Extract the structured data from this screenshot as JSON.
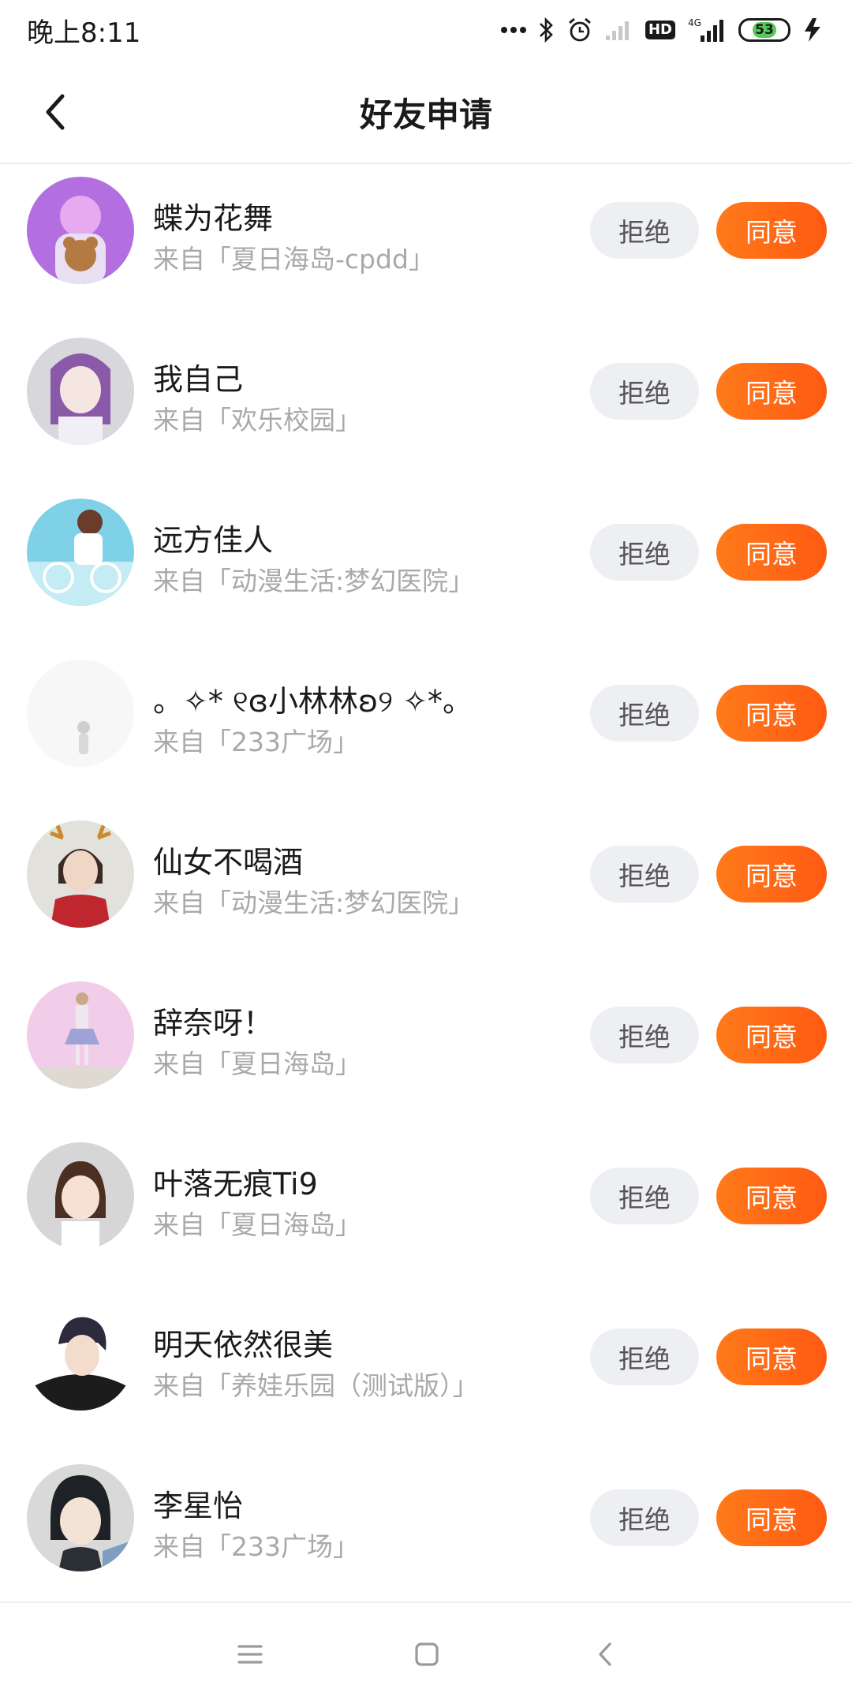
{
  "status_bar": {
    "time": "晚上8:11",
    "network": "4G",
    "hd": "HD",
    "battery": "53"
  },
  "header": {
    "title": "好友申请"
  },
  "buttons": {
    "reject": "拒绝",
    "accept": "同意"
  },
  "requests": [
    {
      "name": "蝶为花舞",
      "source": "来自「夏日海岛-cpdd」",
      "avatar_color": "#b36fe0"
    },
    {
      "name": "我自己",
      "source": "来自「欢乐校园」",
      "avatar_color": "#d7d7dc"
    },
    {
      "name": "远方佳人",
      "source": "来自「动漫生活:梦幻医院」",
      "avatar_color": "#7fd1e8"
    },
    {
      "name": "。✧* ୧ɞ小林林ʚ୨ ✧*。",
      "source": "来自「233广场」",
      "avatar_color": "#f7f7f7"
    },
    {
      "name": "仙女不喝酒",
      "source": "来自「动漫生活:梦幻医院」",
      "avatar_color": "#e3e1dc"
    },
    {
      "name": "辞奈呀！",
      "source": "来自「夏日海岛」",
      "avatar_color": "#f2cde9"
    },
    {
      "name": "叶落无痕Ti9",
      "source": "来自「夏日海岛」",
      "avatar_color": "#d6d6d6"
    },
    {
      "name": "明天依然很美",
      "source": "来自「养娃乐园（测试版）」",
      "avatar_color": "#1c1c1c"
    },
    {
      "name": "李星怡",
      "source": "来自「233广场」",
      "avatar_color": "#d9d9d9"
    }
  ],
  "colors": {
    "accent": "#ff6a14",
    "reject_bg": "#eeeff3"
  }
}
